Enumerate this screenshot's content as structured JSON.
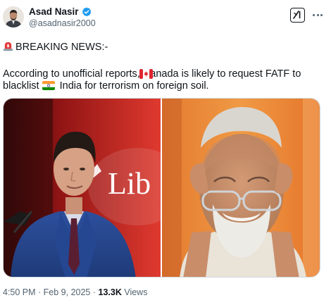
{
  "tweet": {
    "author_name": "Asad Nasir",
    "author_handle": "@asadnasir2000",
    "line1": "BREAKING NEWS:-",
    "line2": "According to unofficial reports,  Canada is likely to request FATF to",
    "line3_a": "blacklist ",
    "line3_b": " India for terrorism on foreign soil.",
    "time": "4:50 PM · Feb 9, 2025 · ",
    "views_count": "13.3K",
    "views_label": " Views",
    "left_image_banner_text": "Lib"
  },
  "colors": {
    "verified": "#1d9bf0",
    "text": "#0f1419",
    "muted": "#536471",
    "border": "#cfd9de"
  },
  "icons": {
    "siren": "police-light-emoji",
    "canada": "canada-flag-emoji",
    "india": "india-flag-emoji",
    "verified": "verified-badge-icon",
    "grok": "grok-icon",
    "more": "more-options-icon"
  }
}
